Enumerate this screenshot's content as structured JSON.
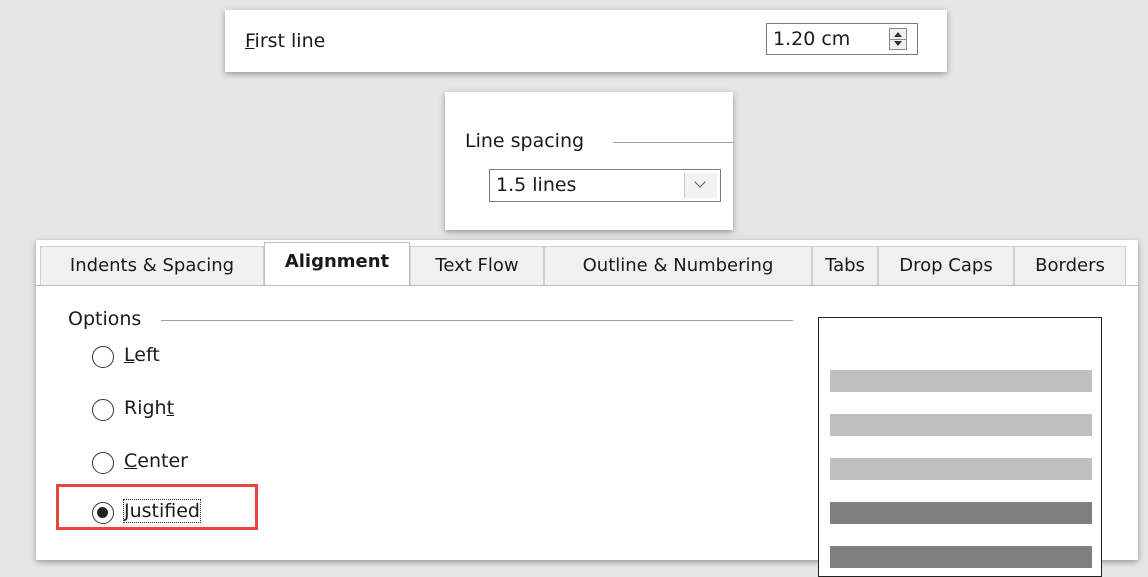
{
  "first_line": {
    "label_accel": "F",
    "label_rest": "irst line",
    "value": "1.20 cm"
  },
  "line_spacing": {
    "legend": "Line spacing",
    "value": "1.5 lines"
  },
  "dialog": {
    "tabs": [
      "Indents & Spacing",
      "Alignment",
      "Text Flow",
      "Outline & Numbering",
      "Tabs",
      "Drop Caps",
      "Borders"
    ],
    "active_tab": "Alignment",
    "options": {
      "legend": "Options",
      "radios": [
        {
          "pre": "",
          "accel": "L",
          "post": "eft",
          "checked": false
        },
        {
          "pre": "Righ",
          "accel": "t",
          "post": "",
          "checked": false
        },
        {
          "pre": "",
          "accel": "C",
          "post": "enter",
          "checked": false
        },
        {
          "pre": "",
          "accel": "J",
          "post": "ustified",
          "checked": true
        }
      ]
    },
    "preview_line_colors": [
      "#c0c0c0",
      "#c0c0c0",
      "#c0c0c0",
      "#808080",
      "#808080"
    ]
  },
  "colors": {
    "highlight_border": "#e8473d"
  }
}
